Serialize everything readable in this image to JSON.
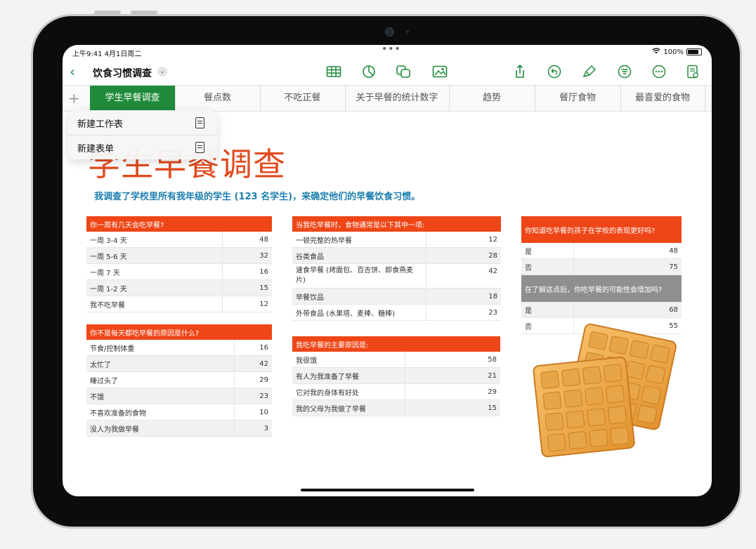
{
  "status": {
    "time": "上午9:41  4月1日周二",
    "battery": "100%"
  },
  "toolbar": {
    "title": "饮食习惯调查"
  },
  "tabs": [
    "学生早餐调查",
    "餐点数",
    "不吃正餐",
    "关于早餐的统计数字",
    "趋势",
    "餐厅食物",
    "最喜爱的食物"
  ],
  "menu": {
    "new_sheet": "新建工作表",
    "new_form": "新建表单"
  },
  "page": {
    "title": "学生早餐调查",
    "subtitle": "我调查了学校里所有我年级的学生 (123 名学生)，来确定他们的早餐饮食习惯。"
  },
  "tables": {
    "t1": {
      "header": "你一周有几天会吃早餐?",
      "rows": [
        [
          "一周 3-4 天",
          "48"
        ],
        [
          "一周 5-6 天",
          "32"
        ],
        [
          "一周 7 天",
          "16"
        ],
        [
          "一周 1-2 天",
          "15"
        ],
        [
          "我不吃早餐",
          "12"
        ]
      ]
    },
    "t2": {
      "header": "你不是每天都吃早餐的原因是什么?",
      "rows": [
        [
          "节食/控制体重",
          "16"
        ],
        [
          "太忙了",
          "42"
        ],
        [
          "睡过头了",
          "29"
        ],
        [
          "不饿",
          "23"
        ],
        [
          "不喜欢准备的食物",
          "10"
        ],
        [
          "没人为我做早餐",
          "3"
        ]
      ]
    },
    "t3": {
      "header": "当我吃早餐时，食物通常是以下其中一项:",
      "rows": [
        [
          "一顿完整的热早餐",
          "12"
        ],
        [
          "谷类食品",
          "28"
        ],
        [
          "速食早餐 (烤面包、百吉饼、即食燕麦片)",
          "42"
        ],
        [
          "早餐饮品",
          "18"
        ],
        [
          "外带食品 (水果塔、麦棒、糖棒)",
          "23"
        ]
      ]
    },
    "t4": {
      "header": "我吃早餐的主要原因是:",
      "rows": [
        [
          "我很饿",
          "58"
        ],
        [
          "有人为我准备了早餐",
          "21"
        ],
        [
          "它对我的身体有好处",
          "29"
        ],
        [
          "我的父母为我做了早餐",
          "15"
        ]
      ]
    },
    "t5": {
      "header": "你知道吃早餐的孩子在学校的表现更好吗?",
      "rows": [
        [
          "是",
          "48"
        ],
        [
          "否",
          "75"
        ]
      ]
    },
    "t6": {
      "header": "在了解这点后，你吃早餐的可能性会增加吗?",
      "rows": [
        [
          "是",
          "68"
        ],
        [
          "否",
          "55"
        ]
      ]
    }
  }
}
